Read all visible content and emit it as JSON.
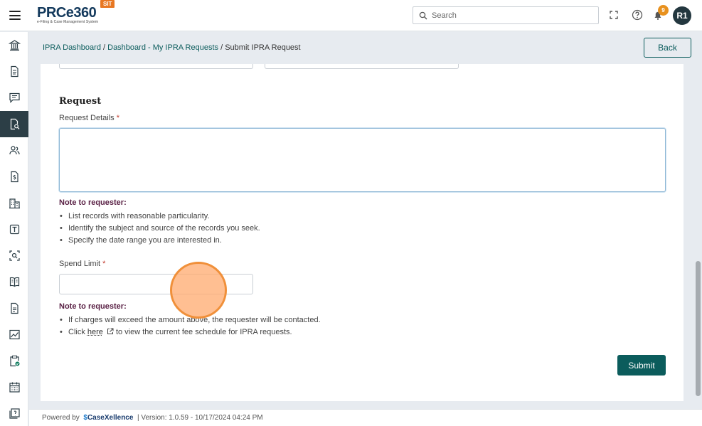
{
  "header": {
    "logo_main": "PRCe360",
    "logo_sub": "e-Filing & Case Management System",
    "env_badge": "SIT",
    "search_placeholder": "Search",
    "notification_count": "9",
    "user_initials": "R1"
  },
  "sidebar": {
    "items": [
      {
        "name": "bank-icon"
      },
      {
        "name": "document-icon"
      },
      {
        "name": "chat-icon"
      },
      {
        "name": "document-search-icon",
        "active": true
      },
      {
        "name": "users-icon"
      },
      {
        "name": "fee-document-icon"
      },
      {
        "name": "building-icon"
      },
      {
        "name": "template-icon"
      },
      {
        "name": "scan-search-icon"
      },
      {
        "name": "book-icon"
      },
      {
        "name": "file-icon"
      },
      {
        "name": "chart-icon"
      },
      {
        "name": "clipboard-icon"
      },
      {
        "name": "calendar-icon"
      },
      {
        "name": "report-icon"
      }
    ]
  },
  "breadcrumb": {
    "link1": "IPRA Dashboard",
    "link2": "Dashboard - My IPRA Requests",
    "current": "Submit IPRA Request",
    "sep": "/"
  },
  "back_label": "Back",
  "form": {
    "section_title": "Request",
    "request_details_label": "Request Details",
    "required_mark": "*",
    "note_label": "Note to requester:",
    "notes1": [
      "List records with reasonable particularity.",
      "Identify the subject and source of the records you seek.",
      "Specify the date range you are interested in."
    ],
    "spend_limit_label": "Spend Limit",
    "notes2_item1": "If charges will exceed the amount above, the requester will be contacted.",
    "notes2_item2_prefix": "Click",
    "notes2_item2_link": "here",
    "notes2_item2_suffix": "to view the current fee schedule for IPRA requests.",
    "submit_label": "Submit"
  },
  "footer": {
    "powered_by": "Powered by",
    "brand": "CaseXellence",
    "version": "|  Version: 1.0.59 - 10/17/2024 04:24 PM"
  },
  "colors": {
    "primary": "#0b5c5c",
    "nav_active": "#2c3e46",
    "note_label": "#5a2145",
    "badge": "#e8911e"
  }
}
